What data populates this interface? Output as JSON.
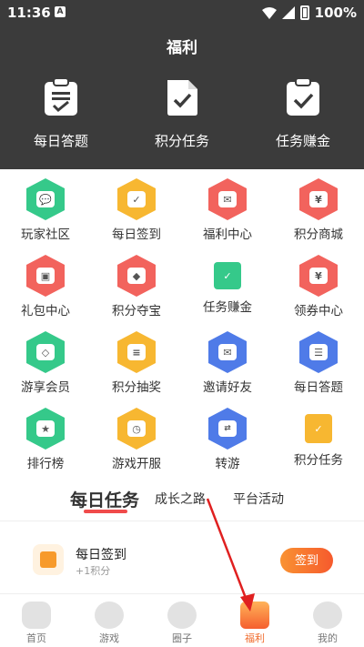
{
  "status_bar": {
    "time": "11:36",
    "battery": "100%"
  },
  "header": {
    "title": "福利"
  },
  "quick_actions": [
    {
      "label": "每日答题",
      "icon": "clipboard-list-icon"
    },
    {
      "label": "积分任务",
      "icon": "document-check-icon"
    },
    {
      "label": "任务赚金",
      "icon": "clipboard-check-icon"
    }
  ],
  "grid": [
    {
      "label": "玩家社区",
      "color": "#35c98a",
      "icon": "chat-icon"
    },
    {
      "label": "每日签到",
      "color": "#f7b731",
      "icon": "calendar-icon"
    },
    {
      "label": "福利中心",
      "color": "#f2635d",
      "icon": "gift-envelope-icon"
    },
    {
      "label": "积分商城",
      "color": "#f2635d",
      "icon": "store-icon"
    },
    {
      "label": "礼包中心",
      "color": "#f2635d",
      "icon": "gift-box-icon"
    },
    {
      "label": "积分夺宝",
      "color": "#f2635d",
      "icon": "treasure-icon"
    },
    {
      "label": "任务赚金",
      "color": "#35c98a",
      "icon": "task-check-icon"
    },
    {
      "label": "领券中心",
      "color": "#f2635d",
      "icon": "coupon-icon"
    },
    {
      "label": "游享会员",
      "color": "#35c98a",
      "icon": "diamond-icon"
    },
    {
      "label": "积分抽奖",
      "color": "#f7b731",
      "icon": "coins-icon"
    },
    {
      "label": "邀请好友",
      "color": "#4f7be8",
      "icon": "mail-icon"
    },
    {
      "label": "每日答题",
      "color": "#4f7be8",
      "icon": "clipboard-icon"
    },
    {
      "label": "排行榜",
      "color": "#35c98a",
      "icon": "trophy-icon"
    },
    {
      "label": "游戏开服",
      "color": "#f7b731",
      "icon": "server-clock-icon"
    },
    {
      "label": "转游",
      "color": "#4f7be8",
      "icon": "transfer-icon"
    },
    {
      "label": "积分任务",
      "color": "#f7b731",
      "icon": "document-check-icon"
    }
  ],
  "tabs": [
    {
      "label": "每日任务",
      "active": true
    },
    {
      "label": "成长之路",
      "active": false
    },
    {
      "label": "平台活动",
      "active": false
    }
  ],
  "task": {
    "title": "每日签到",
    "subtitle": "+1积分",
    "button": "签到"
  },
  "bottom_nav": [
    {
      "label": "首页",
      "icon": "gamepad-icon",
      "active": false
    },
    {
      "label": "游戏",
      "icon": "heart-icon",
      "active": false
    },
    {
      "label": "圈子",
      "icon": "circle-chat-icon",
      "active": false
    },
    {
      "label": "福利",
      "icon": "gift-icon",
      "active": true
    },
    {
      "label": "我的",
      "icon": "glasses-face-icon",
      "active": false
    }
  ],
  "colors": {
    "header_bg": "#3b3b3b",
    "accent": "#f06a2a",
    "arrow": "#e02020"
  }
}
